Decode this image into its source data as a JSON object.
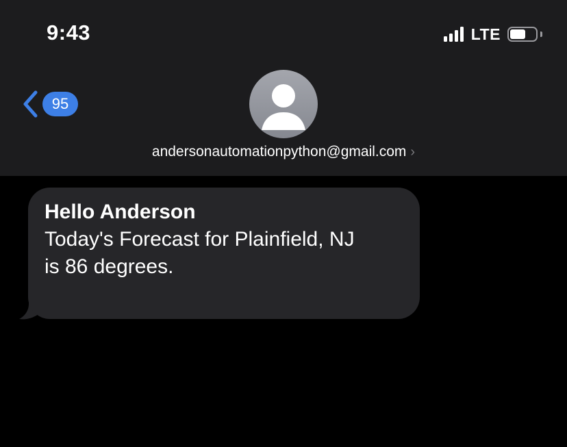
{
  "status_bar": {
    "time": "9:43",
    "network": "LTE",
    "signal_bars": 4,
    "battery_level": 0.6
  },
  "nav": {
    "back_badge": "95",
    "contact": "andersonautomationpython@gmail.com",
    "contact_chevron": "›"
  },
  "message": {
    "title": "Hello Anderson",
    "line1": "Today's Forecast for Plainfield, NJ",
    "line2": "is 86 degrees."
  },
  "colors": {
    "header_bg": "#1c1c1e",
    "background": "#000000",
    "bubble_bg": "#262629",
    "accent": "#3d7fe6"
  }
}
